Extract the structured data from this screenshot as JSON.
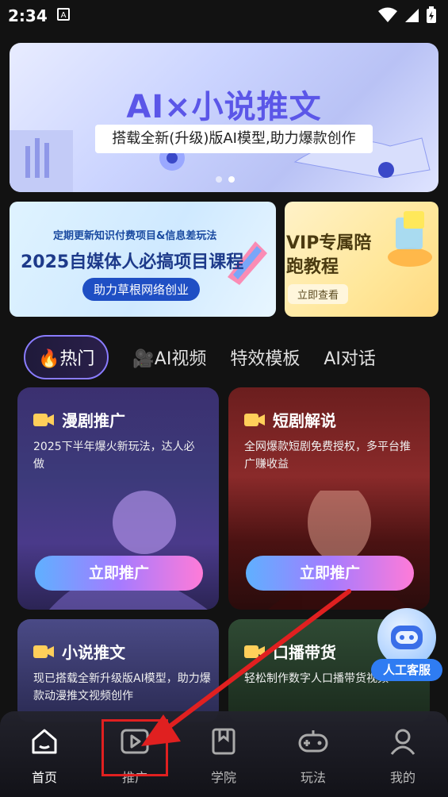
{
  "status": {
    "time": "2:34",
    "badge": "A"
  },
  "banner": {
    "title": "AI×小说推文",
    "subtitle": "搭载全新(升级)版AI模型,助力爆款创作"
  },
  "card_left": {
    "top_text": "定期更新知识付费项目&信息差玩法",
    "main_text": "2025自媒体人必搞项目课程",
    "button": "助力草根网络创业"
  },
  "card_right": {
    "title": "VIP专属陪跑教程",
    "button": "立即查看"
  },
  "tabs": [
    {
      "label": "🔥热门"
    },
    {
      "label": "🎥AI视频"
    },
    {
      "label": "特效模板"
    },
    {
      "label": "AI对话"
    }
  ],
  "promos": [
    {
      "title": "漫剧推广",
      "desc": "2025下半年爆火新玩法，达人必做",
      "button": "立即推广"
    },
    {
      "title": "短剧解说",
      "desc": "全网爆款短剧免费授权，多平台推广赚收益",
      "button": "立即推广"
    },
    {
      "title": "小说推文",
      "desc": "现已搭载全新升级版AI模型，助力爆款动漫推文视频创作"
    },
    {
      "title": "口播带货",
      "desc": "轻松制作数字人口播带货视频"
    }
  ],
  "service": {
    "label": "人工客服"
  },
  "nav": [
    {
      "label": "首页",
      "icon": "home-icon"
    },
    {
      "label": "推广",
      "icon": "play-icon"
    },
    {
      "label": "学院",
      "icon": "book-icon"
    },
    {
      "label": "玩法",
      "icon": "gamepad-icon"
    },
    {
      "label": "我的",
      "icon": "user-icon"
    }
  ],
  "colors": {
    "accent": "#8a7cff",
    "annotation": "#e02020",
    "service": "#2f7cf2"
  }
}
